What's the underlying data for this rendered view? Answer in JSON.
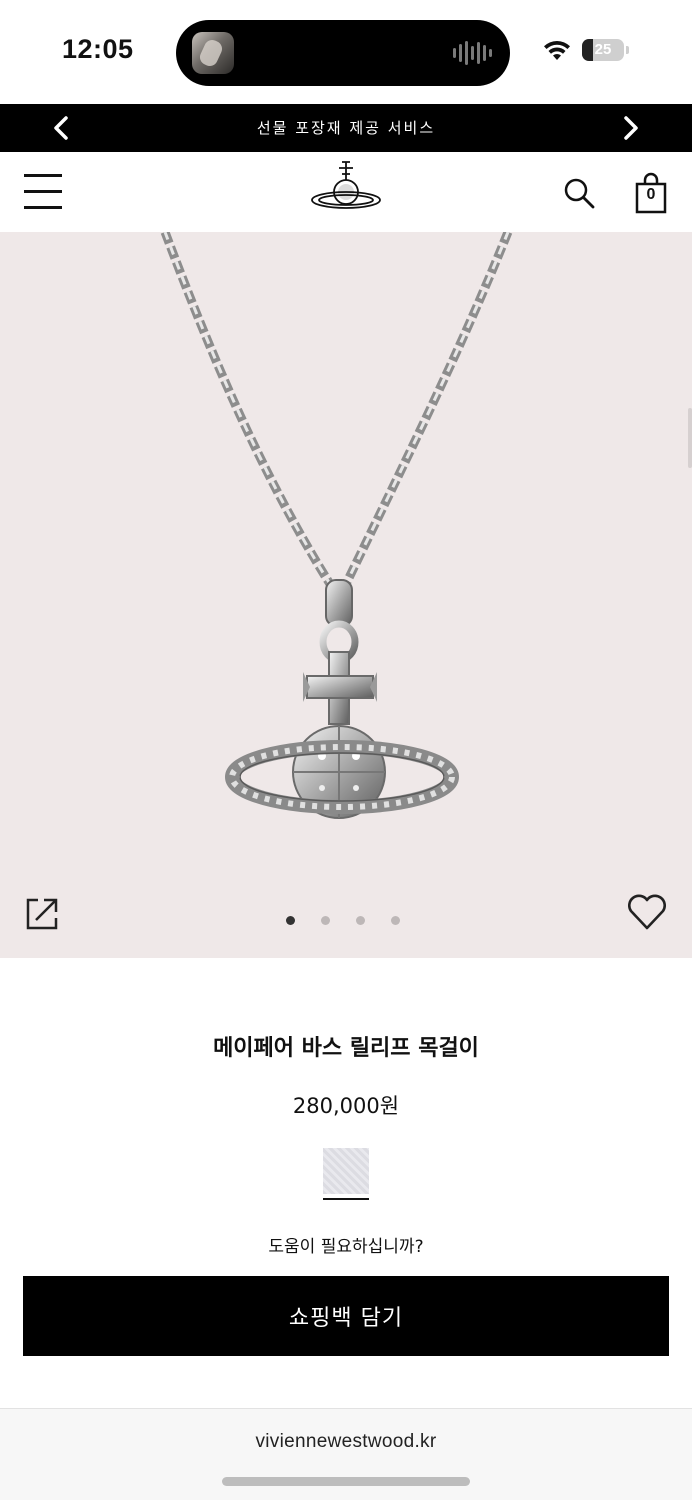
{
  "status": {
    "time": "12:05",
    "battery_level": "25",
    "battery_fraction": 0.25
  },
  "promo": {
    "text": "선물 포장재 제공 서비스"
  },
  "header": {
    "cart_count": "0"
  },
  "gallery": {
    "active_index": 0,
    "total_images": 4
  },
  "product": {
    "name": "메이페어 바스 릴리프 목걸이",
    "price": "280,000원",
    "selected_swatch_color": "#e3e3e8"
  },
  "help": {
    "label": "도움이 필요하십니까?"
  },
  "cta": {
    "add_to_bag_label": "쇼핑백 담기"
  },
  "browser": {
    "url": "viviennewestwood.kr"
  },
  "colors": {
    "banner_bg": "#000000",
    "gallery_bg": "#efe8e8",
    "button_bg": "#000000"
  }
}
